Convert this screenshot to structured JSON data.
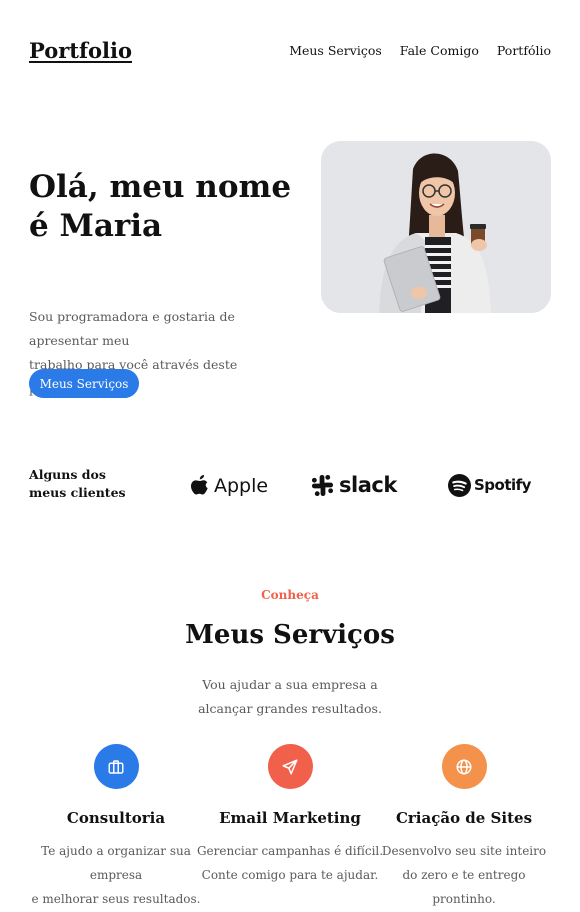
{
  "header": {
    "logo": "Portfolio",
    "nav": [
      "Meus Serviços",
      "Fale Comigo",
      "Portfólio"
    ]
  },
  "hero": {
    "title_line1": "Olá, meu nome",
    "title_line2": "é Maria",
    "description_line1": "Sou programadora e gostaria de apresentar meu",
    "description_line2": "trabalho para você através deste portfólio.",
    "button_label": "Meus Serviços",
    "button_color": "#2a7ae8"
  },
  "clients": {
    "label_line1": "Alguns dos",
    "label_line2": "meus clientes",
    "logos": [
      "Apple",
      "slack",
      "Spotify"
    ]
  },
  "services": {
    "eyebrow": "Conheça",
    "title": "Meus Serviços",
    "subtitle_line1": "Vou ajudar a sua empresa a",
    "subtitle_line2": "alcançar grandes resultados.",
    "items": [
      {
        "name": "Consultoria",
        "desc_line1": "Te ajudo a organizar sua empresa",
        "desc_line2": "e melhorar seus resultados.",
        "icon": "briefcase-icon",
        "color": "#2a7ae8"
      },
      {
        "name": "Email Marketing",
        "desc_line1": "Gerenciar campanhas é difícil.",
        "desc_line2": "Conte comigo para te ajudar.",
        "icon": "send-icon",
        "color": "#f0604b"
      },
      {
        "name": "Criação de Sites",
        "desc_line1": "Desenvolvo seu site inteiro",
        "desc_line2": "do zero e te entrego prontinho.",
        "icon": "globe-icon",
        "color": "#f4914a"
      }
    ]
  }
}
